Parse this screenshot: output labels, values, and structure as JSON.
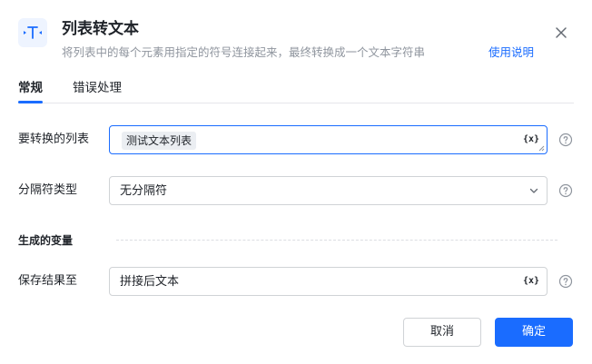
{
  "header": {
    "title": "列表转文本",
    "description": "将列表中的每个元素用指定的符号连接起来，最终转换成一个文本字符串",
    "help_link": "使用说明"
  },
  "tabs": [
    {
      "label": "常规",
      "active": true
    },
    {
      "label": "错误处理",
      "active": false
    }
  ],
  "form": {
    "list_to_convert": {
      "label": "要转换的列表",
      "value": "测试文本列表",
      "var_button": "{x}"
    },
    "separator_type": {
      "label": "分隔符类型",
      "value": "无分隔符"
    },
    "output_section_title": "生成的变量",
    "save_result_to": {
      "label": "保存结果至",
      "value": "拼接后文本",
      "var_button": "{x}"
    }
  },
  "footer": {
    "cancel_label": "取消",
    "ok_label": "确定"
  },
  "colors": {
    "accent": "#1a6cff",
    "muted_text": "#8f959e",
    "border": "#d0d3d6"
  }
}
